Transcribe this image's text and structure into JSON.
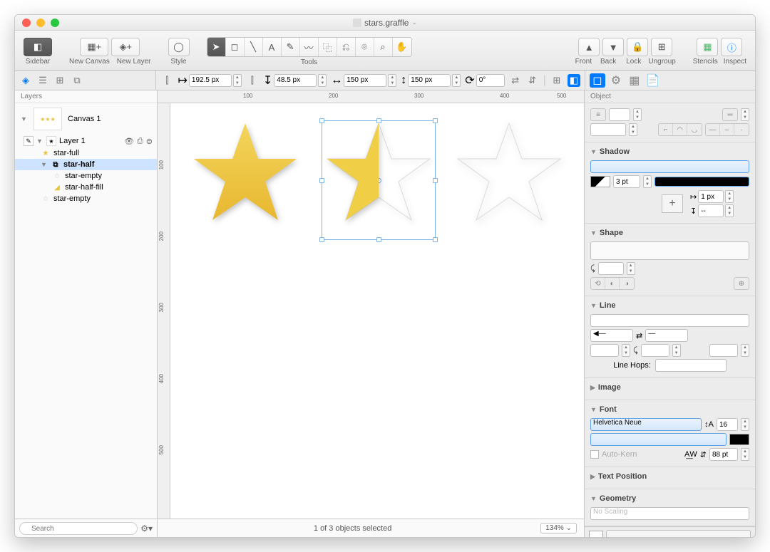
{
  "window": {
    "title": "stars.graffle"
  },
  "toolbar": {
    "sidebar": "Sidebar",
    "new_canvas": "New Canvas",
    "new_layer": "New Layer",
    "style": "Style",
    "tools": "Tools",
    "front": "Front",
    "back": "Back",
    "lock": "Lock",
    "ungroup": "Ungroup",
    "stencils": "Stencils",
    "inspect": "Inspect"
  },
  "properties": {
    "x": "192.5 px",
    "y": "48.5 px",
    "w": "150 px",
    "h": "150 px",
    "rotation": "0°"
  },
  "sidebar": {
    "header": "Layers",
    "canvas": "Canvas 1",
    "layer": "Layer 1",
    "items": [
      {
        "name": "star-full",
        "color": "#e8c23a"
      },
      {
        "name": "star-half",
        "selected": true
      },
      {
        "name": "star-empty",
        "indent": true,
        "color": "#ccc"
      },
      {
        "name": "star-half-fill",
        "indent": true,
        "color": "#e8c23a"
      },
      {
        "name": "star-empty",
        "color": "#ccc"
      }
    ],
    "search_placeholder": "Search"
  },
  "ruler": {
    "h": [
      "100",
      "200",
      "300",
      "400",
      "500"
    ],
    "v": [
      "100",
      "200",
      "300",
      "400",
      "500"
    ]
  },
  "status": {
    "selection": "1 of 3 objects selected",
    "zoom": "134%"
  },
  "inspector": {
    "header": "Object",
    "shadow": {
      "title": "Shadow",
      "stroke": "3 pt",
      "offset": "1 px",
      "blur": "--"
    },
    "shape": {
      "title": "Shape"
    },
    "line": {
      "title": "Line",
      "hops_label": "Line Hops:"
    },
    "image": {
      "title": "Image"
    },
    "font": {
      "title": "Font",
      "family": "Helvetica Neue",
      "size": "16",
      "autokern": "Auto-Kern",
      "spacing": "88 pt"
    },
    "text_position": {
      "title": "Text Position"
    },
    "geometry": {
      "title": "Geometry",
      "scaling": "No Scaling"
    }
  }
}
